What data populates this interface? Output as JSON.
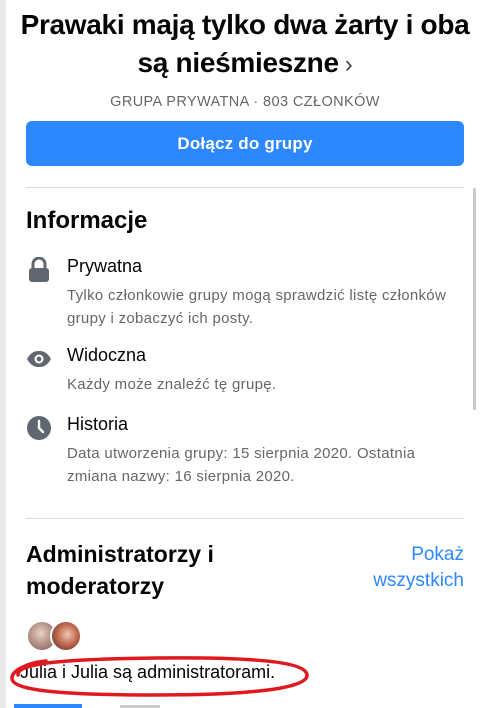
{
  "group": {
    "title": "Prawaki mają tylko dwa żarty i oba są nieśmieszne",
    "chevron": "›",
    "meta": "GRUPA PRYWATNA · 803 CZŁONKÓW"
  },
  "join_button": {
    "label": "Dołącz do grupy"
  },
  "info": {
    "title": "Informacje",
    "items": [
      {
        "icon": "lock-icon",
        "label": "Prywatna",
        "desc": "Tylko członkowie grupy mogą sprawdzić listę członków grupy i zobaczyć ich posty."
      },
      {
        "icon": "eye-icon",
        "label": "Widoczna",
        "desc": "Każdy może znaleźć tę grupę."
      },
      {
        "icon": "clock-icon",
        "label": "Historia",
        "desc": "Data utworzenia grupy: 15 sierpnia 2020. Ostatnia zmiana nazwy: 16 sierpnia 2020."
      }
    ]
  },
  "admins": {
    "title": "Administratorzy i moderatorzy",
    "show_all": "Pokaż wszystkich",
    "text": "Julia i Julia są administratorami."
  },
  "colors": {
    "accent": "#2d88ff",
    "secondary_text": "#65676b",
    "highlight_circle": "#e0191f"
  }
}
